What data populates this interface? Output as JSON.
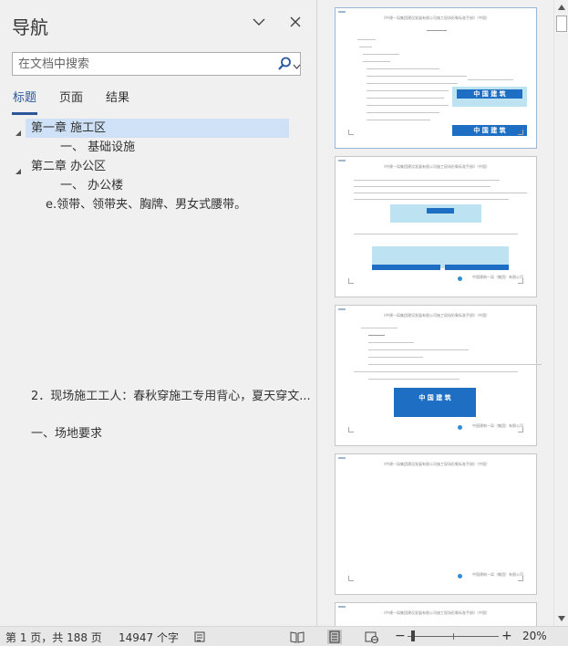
{
  "nav": {
    "title": "导航",
    "search_placeholder": "在文档中搜索",
    "tabs": [
      "标题",
      "页面",
      "结果"
    ],
    "active_tab": 0,
    "headings": [
      {
        "text": "第一章  施工区",
        "level": 1,
        "expanded": true,
        "selected": true
      },
      {
        "text": "一、  基础设施",
        "level": 2,
        "expanded": false,
        "selected": false
      },
      {
        "text": "第二章  办公区",
        "level": 1,
        "expanded": true,
        "selected": false
      },
      {
        "text": "一、  办公楼",
        "level": 2,
        "expanded": false,
        "selected": false
      },
      {
        "text": "e.领带、领带夹、胸牌、男女式腰带。",
        "level": 3,
        "expanded": false,
        "selected": false
      },
      {
        "text": "2．现场施工工人：春秋穿施工专用背心，夏天穿文...",
        "level": 3,
        "expanded": false,
        "selected": false
      },
      {
        "text": "一、场地要求",
        "level": 3,
        "expanded": false,
        "selected": false
      }
    ]
  },
  "thumbnails": {
    "header_text": "《中建一局集团建设发展有限公司施工现场形象标准手册》（中国）",
    "footer_text": "中国建筑一局（集团）有限公司",
    "banner_text": "中 国 建 筑",
    "pages": [
      {
        "page": 1,
        "selected": true
      },
      {
        "page": 2,
        "selected": false
      },
      {
        "page": 3,
        "selected": false
      },
      {
        "page": 4,
        "selected": false
      }
    ]
  },
  "status": {
    "page_info": "第 1 页，共 188 页",
    "word_count": "14947 个字",
    "zoom_level": "20%",
    "zoom_fraction": 0.2
  },
  "colors": {
    "accent": "#2b579a",
    "selection": "#cfe1f7",
    "banner_blue": "#1e6fc3"
  }
}
